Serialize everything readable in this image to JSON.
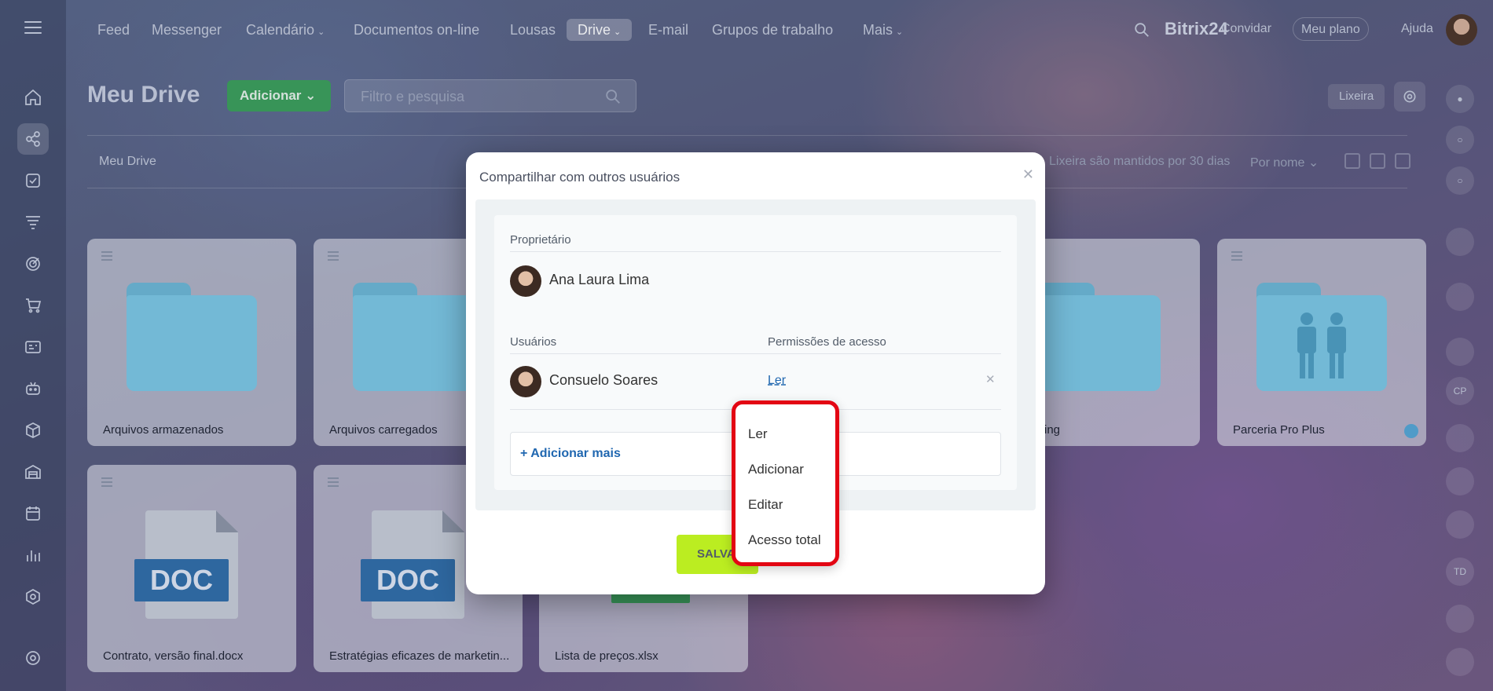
{
  "nav": {
    "items": [
      {
        "label": "Feed",
        "chevron": false
      },
      {
        "label": "Messenger",
        "chevron": false
      },
      {
        "label": "Calendário",
        "chevron": true
      },
      {
        "label": "Documentos on-line",
        "chevron": false
      },
      {
        "label": "Lousas",
        "chevron": false
      },
      {
        "label": "Drive",
        "chevron": true,
        "active": true
      },
      {
        "label": "E-mail",
        "chevron": false
      },
      {
        "label": "Grupos de trabalho",
        "chevron": false
      },
      {
        "label": "Mais",
        "chevron": true
      }
    ],
    "brand": "Bitrix24",
    "invite": "Convidar",
    "plan": "Meu plano",
    "help": "Ajuda"
  },
  "page": {
    "title": "Meu Drive",
    "add_button": "Adicionar",
    "filter_placeholder": "Filtro e pesquisa",
    "trash_button": "Lixeira",
    "breadcrumb": "Meu Drive",
    "trash_info": "Lixeira são mantidos por 30 dias",
    "sort": "Por nome"
  },
  "files": [
    {
      "name": "Arquivos armazenados",
      "type": "folder"
    },
    {
      "name": "Arquivos carregados",
      "type": "folder"
    },
    {
      "name": "ing",
      "type": "folder"
    },
    {
      "name": "Parceria Pro Plus",
      "type": "folder-shared"
    },
    {
      "name": "Contrato, versão final.docx",
      "type": "doc",
      "badge": "DOC"
    },
    {
      "name": "Estratégias eficazes de marketin...",
      "type": "doc",
      "badge": "DOC"
    },
    {
      "name": "Lista de preços.xlsx",
      "type": "xls"
    }
  ],
  "rightbar": {
    "initials": [
      "CP",
      "TD"
    ]
  },
  "modal": {
    "title": "Compartilhar com outros usuários",
    "owner_label": "Proprietário",
    "owner_name": "Ana Laura Lima",
    "users_label": "Usuários",
    "perms_label": "Permissões de acesso",
    "user_name": "Consuelo Soares",
    "user_perm": "Ler",
    "add_more": "+ Adicionar mais",
    "save": "SALVAR"
  },
  "dropdown": {
    "options": [
      "Ler",
      "Adicionar",
      "Editar",
      "Acesso total"
    ],
    "highlight_color": "#e30613"
  },
  "colors": {
    "accent": "#bbed21",
    "link": "#2067b0",
    "add_button": "#3aa05a"
  }
}
